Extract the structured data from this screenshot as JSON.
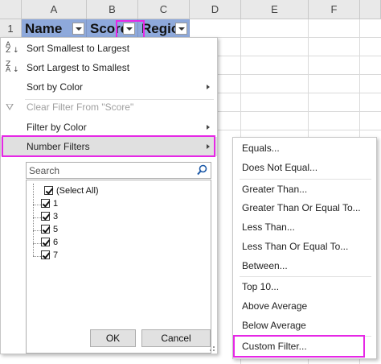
{
  "spreadsheet": {
    "columns": [
      "A",
      "B",
      "C",
      "D",
      "E",
      "F"
    ],
    "row_header": "1",
    "header_cells": {
      "name": "Name",
      "score": "Score",
      "region": "Regio"
    },
    "header_fill": "#8ea9db"
  },
  "filter_menu": {
    "sort_asc": "Sort Smallest to Largest",
    "sort_desc": "Sort Largest to Smallest",
    "sort_color": "Sort by Color",
    "clear_filter": "Clear Filter From \"Score\"",
    "filter_color": "Filter by Color",
    "number_filters": "Number Filters",
    "search": {
      "placeholder": "Search",
      "value": ""
    },
    "values": [
      {
        "label": "(Select All)",
        "checked": true
      },
      {
        "label": "1",
        "checked": true
      },
      {
        "label": "3",
        "checked": true
      },
      {
        "label": "5",
        "checked": true
      },
      {
        "label": "6",
        "checked": true
      },
      {
        "label": "7",
        "checked": true
      }
    ],
    "ok": "OK",
    "cancel": "Cancel"
  },
  "number_filters_submenu": {
    "items": [
      "Equals...",
      "Does Not Equal...",
      "Greater Than...",
      "Greater Than Or Equal To...",
      "Less Than...",
      "Less Than Or Equal To...",
      "Between...",
      "Top 10...",
      "Above Average",
      "Below Average",
      "Custom Filter..."
    ]
  },
  "highlight_color": "#e628e6",
  "icons": {
    "sort_asc": "sort-az-icon",
    "sort_desc": "sort-za-icon",
    "clear_filter": "clear-filter-icon",
    "search": "search-icon",
    "dropdown": "chevron-down-icon",
    "submenu": "chevron-right-icon"
  }
}
